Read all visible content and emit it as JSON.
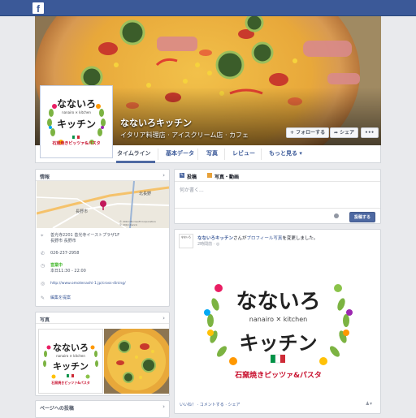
{
  "topbar": {
    "logo": "f"
  },
  "page": {
    "name": "なないろキッチン",
    "category": "イタリア料理店 · アイスクリーム店 · カフェ",
    "follow_label": "フォローする",
    "share_label": "シェア",
    "more_label": "•••"
  },
  "logo": {
    "line1": "なないろ",
    "sub": "nanairo",
    "sub2": "kitchen",
    "line2": "キッチン",
    "tagline": "石窯焼きピッツァ&パスタ"
  },
  "nav": {
    "tabs": [
      "タイムライン",
      "基本データ",
      "写真",
      "レビュー",
      "もっと見る ▾"
    ]
  },
  "info_card": {
    "title": "情報",
    "map_labels": [
      "長野市",
      "北長野"
    ],
    "map_copyright": "© 2014 Microsoft Corporation\n© 2014 Zenrin",
    "address_line1": "善光寺2201  善光寺イーストプラザ1F",
    "address_line2": "長野市  長野市",
    "phone": "026-237-2958",
    "status": "営業中",
    "hours": "本日11:30 - 22:00",
    "website": "http://www.omotenashi-1.jp/cross-dining/",
    "edit": "編集を提案"
  },
  "photos_card": {
    "title": "写真"
  },
  "pageposts_card": {
    "title": "ページへの投稿"
  },
  "composer": {
    "tab_post": "投稿",
    "tab_photo": "写真・動画",
    "placeholder": "何か書く...",
    "post_button": "投稿する"
  },
  "feed_post": {
    "author": "なないろキッチン",
    "action": "さんが",
    "link_text": "プロフィール写真",
    "suffix": "を変更しました。",
    "time": "2時間前 · ",
    "actions": "いいね！ · コメントする · シェア"
  },
  "colors": {
    "fb_blue": "#3b5998",
    "accent_pink": "#c2185b",
    "brand_red": "#c8102e",
    "leaf_green": "#7cb342"
  }
}
